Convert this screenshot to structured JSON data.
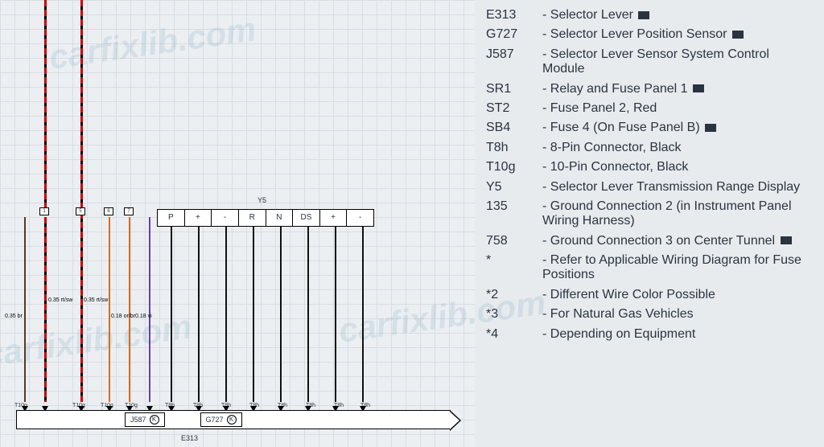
{
  "legend": [
    {
      "code": "E313",
      "desc": "Selector Lever",
      "ref": true
    },
    {
      "code": "G727",
      "desc": "Selector Lever Position Sensor",
      "ref": true
    },
    {
      "code": "J587",
      "desc": "Selector Lever Sensor System Control Module",
      "ref": false
    },
    {
      "code": "SR1",
      "desc": "Relay and Fuse Panel 1",
      "ref": true
    },
    {
      "code": "ST2",
      "desc": "Fuse Panel 2, Red",
      "ref": false
    },
    {
      "code": "SB4",
      "desc": "Fuse 4 (On Fuse Panel B)",
      "ref": true
    },
    {
      "code": "T8h",
      "desc": "8-Pin Connector, Black",
      "ref": false
    },
    {
      "code": "T10g",
      "desc": "10-Pin Connector, Black",
      "ref": false
    },
    {
      "code": "Y5",
      "desc": "Selector Lever Transmission Range Display",
      "ref": false
    },
    {
      "code": "135",
      "desc": "Ground Connection 2 (in Instrument Panel Wiring Harness)",
      "ref": false
    },
    {
      "code": "758",
      "desc": "Ground Connection 3 on Center Tunnel",
      "ref": true
    },
    {
      "code": "*",
      "desc": "Refer to Applicable Wiring Diagram for Fuse Positions",
      "ref": false
    },
    {
      "code": "*2",
      "desc": "Different Wire Color Possible",
      "ref": false
    },
    {
      "code": "*3",
      "desc": "For Natural Gas Vehicles",
      "ref": false
    },
    {
      "code": "*4",
      "desc": "Depending on Equipment",
      "ref": false
    }
  ],
  "y5": {
    "label": "Y5",
    "cells": [
      "P",
      "+",
      "-",
      "R",
      "N",
      "DS",
      "+",
      "-"
    ]
  },
  "e313": {
    "label": "E313",
    "sub1": "J587",
    "sub2": "G727"
  },
  "connectors": {
    "t10g": "T10g",
    "t8h": "T8h"
  },
  "wire_annotations": {
    "w1": "0.35\nbr",
    "w2": "0.35\nrt/sw",
    "w3": "0.35\nrt/sw",
    "w4": "0.18\nor/br",
    "w5": "0.18\nvi"
  },
  "conn_pins": [
    "1",
    "5",
    "6",
    "7"
  ],
  "watermark": "carfixlib.com"
}
